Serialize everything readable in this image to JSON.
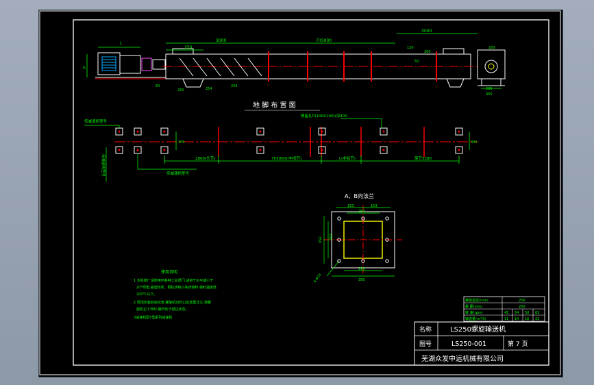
{
  "drawing": {
    "dims_top": {
      "d3000_left": "3000",
      "d250": "250",
      "dn_mid": "Π(5000",
      "d3000_right": "3000",
      "d120": "120",
      "d50": "50",
      "d200": "200",
      "d254": "254",
      "d60": "60",
      "d250_b": "250",
      "d224": "224",
      "d250_c": "250",
      "d200_b": "200",
      "d355": "355",
      "h_left": "h",
      "l_left": "L"
    },
    "layout_title": "地   脚   布   置   图",
    "plan": {
      "hole_note": "预留孔Π(100X100)(深400",
      "label_a": "传减速机型号",
      "label_b": "传减速机型号",
      "label_c": "传减速机型号",
      "seg1": "2860(头节)",
      "seg2": "Π(5000)(中间节)",
      "seg3": "L(非标节)",
      "seg4": "尾节3280",
      "d200": "200",
      "d300": "300"
    },
    "flange": {
      "title": "A、B向法兰",
      "d153a": "153",
      "d153b": "153",
      "d250_top": "250",
      "d350_left": "350",
      "d250_left": "250",
      "d250_bottom": "250",
      "d350_bottom": "350",
      "bolt": "4-Φ14"
    },
    "notes": {
      "title": "使用说明",
      "line1": "1  本机按厂设使用环各种工业部门,适用于水平或小于",
      "line2": "20°倾角,输送粉状、颗粒状和小块状物料,物料温度低",
      "line3": "200°C以下。",
      "line4": "2  现场安装前应检查,螺旋机出料口应放置法兰,使螺",
      "line5": "旋机正工作时,螺杆处于受拉状态。",
      "line6": "3减速机配Y型系列减速机"
    },
    "param_table": {
      "rows": [
        {
          "label": "螺旋直径(mm)",
          "v1": "250"
        },
        {
          "label": "螺  距(mm)",
          "v1": "250"
        },
        {
          "label": "转  速(rpm)",
          "v1": "45",
          "v2": "54",
          "v3": "50",
          "v4": "63"
        },
        {
          "label": "输送量(m³/h)",
          "v1": "11",
          "v2": "14",
          "v3": "16",
          "v4": "22"
        }
      ]
    },
    "title_block": {
      "name_label": "名称",
      "name_value": "LS250螺旋输送机",
      "code_label": "图号",
      "code_value": "LS250-001",
      "page": "第 7 页",
      "company": "芜湖众发中运机械有限公司"
    }
  },
  "colors": {
    "background": "#000000",
    "frame": "#ffffff",
    "dimension": "#00ff00",
    "centerline": "#ff0000",
    "bolt": "#ffff00"
  }
}
